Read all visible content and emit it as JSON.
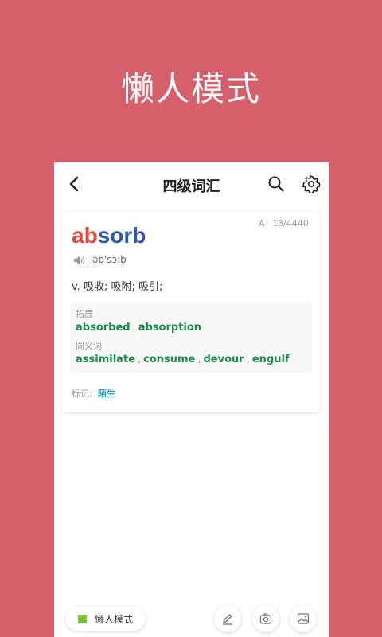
{
  "promo": {
    "title": "懒人模式"
  },
  "header": {
    "title": "四级词汇"
  },
  "card": {
    "level": "A",
    "counter": "13/4440",
    "word_highlight": "ab",
    "word_rest": "sorb",
    "phonetic": "əb'sɔ:b",
    "definition": "v. 吸收; 吸附; 吸引;",
    "extension_label": "拓展",
    "extensions": [
      "absorbed",
      "absorption"
    ],
    "synonym_label": "同义词",
    "synonyms": [
      "assimilate",
      "consume",
      "devour",
      "engulf"
    ],
    "separator": ",",
    "mark_label": "标记:",
    "mark_value": "陌生"
  },
  "bottom": {
    "lazy_mode_label": "懒人模式"
  },
  "colors": {
    "background": "#d65f6c",
    "word_prefix": "#e04a3f",
    "word_rest": "#2f5aa6",
    "related_words": "#1d8a4d",
    "mark": "#2aa1b7",
    "lazy_indicator": "#7cc242"
  }
}
